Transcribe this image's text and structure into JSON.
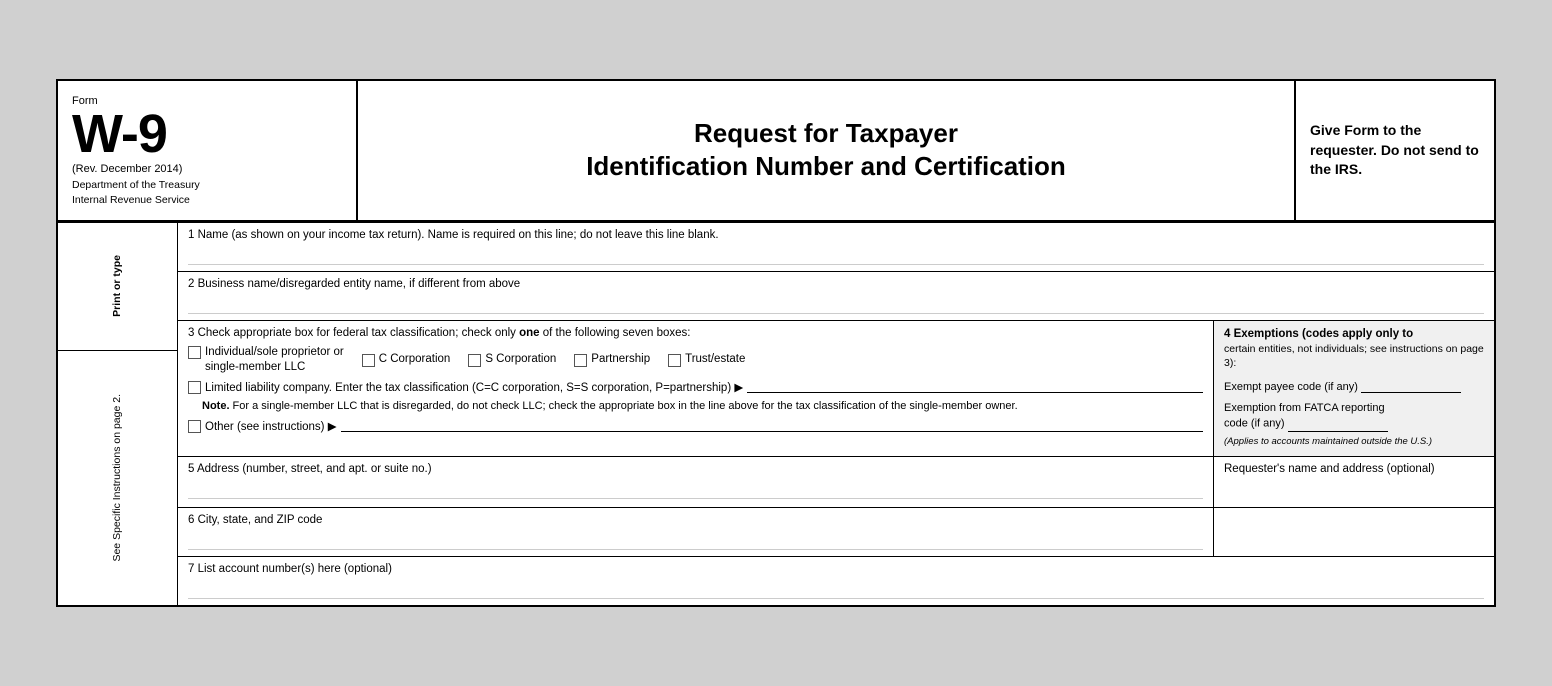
{
  "header": {
    "form_label": "Form",
    "form_number": "W-9",
    "rev": "(Rev. December 2014)",
    "dept_line1": "Department of the Treasury",
    "dept_line2": "Internal Revenue Service",
    "title_line1": "Request for Taxpayer",
    "title_line2": "Identification Number and Certification",
    "right_text": "Give Form to the requester. Do not send to the IRS."
  },
  "side_labels": {
    "top": "Print or type",
    "bottom": "See Specific Instructions on page 2."
  },
  "fields": {
    "field1_label": "1  Name (as shown on your income tax return). Name is required on this line; do not leave this line blank.",
    "field2_label": "2  Business name/disregarded entity name, if different from above",
    "field3_label": "3  Check appropriate box for federal tax classification; check only ",
    "field3_label_bold": "one",
    "field3_label_rest": " of the following seven boxes:",
    "checkbox_individual": "Individual/sole proprietor or\nsingle-member LLC",
    "checkbox_c_corp": "C Corporation",
    "checkbox_s_corp": "S Corporation",
    "checkbox_partnership": "Partnership",
    "checkbox_trust": "Trust/estate",
    "llc_label": "Limited liability company. Enter the tax classification (C=C corporation, S=S corporation, P=partnership) ▶",
    "note_label": "Note.",
    "note_text": " For a single-member LLC that is disregarded, do not check LLC; check the appropriate box in the line above for the tax classification of the single-member owner.",
    "other_label": "Other (see instructions) ▶",
    "field4_title": "4  Exemptions (codes apply only to",
    "field4_sub": "certain entities, not individuals; see instructions on page 3):",
    "exempt_payee": "Exempt payee code (if any)",
    "exempt_fatca": "Exemption from FATCA reporting",
    "code_if_any": "code (if any)",
    "applies_text": "(Applies to accounts maintained outside the U.S.)",
    "field5_label": "5  Address (number, street, and apt. or suite no.)",
    "field5_right": "Requester's name and address (optional)",
    "field6_label": "6  City, state, and ZIP code",
    "field7_label": "7  List account number(s) here (optional)"
  }
}
